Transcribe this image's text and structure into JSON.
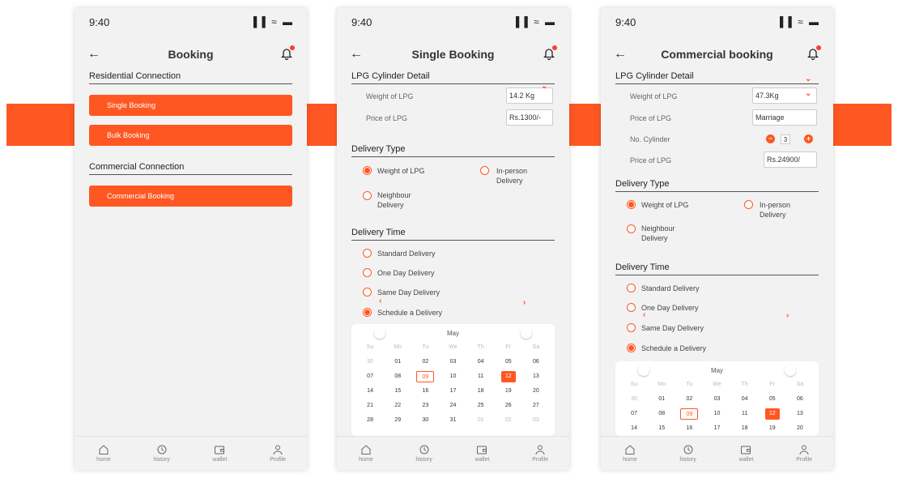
{
  "status": {
    "time": "9:40",
    "icons": "▐▐ ≈ ▬"
  },
  "screen1": {
    "title": "Booking",
    "residential_title": "Residential Connection",
    "single_booking": "Single Booking",
    "bulk_booking": "Bulk Booking",
    "commercial_title": "Commercial Connection",
    "commercial_booking": "Commercial Booking"
  },
  "screen2": {
    "title": "Single Booking",
    "cylinder_title": "LPG Cylinder Detail",
    "weight_label": "Weight of LPG",
    "weight_value": "14.2 Kg",
    "price_label": "Price of LPG",
    "price_value": "Rs.1300/-",
    "delivery_type_title": "Delivery Type",
    "dt_weight": "Weight of LPG",
    "dt_inperson_1": "In-person",
    "dt_inperson_2": "Delivery",
    "dt_neighbour_1": "Neighbour",
    "dt_neighbour_2": "Delivery",
    "delivery_time_title": "Delivery Time",
    "standard": "Standard Delivery",
    "one_day": "One Day Delivery",
    "same_day": "Same Day Delivery",
    "schedule": "Schedule a Delivery",
    "month": "May"
  },
  "screen3": {
    "title": "Commercial booking",
    "cylinder_title": "LPG Cylinder Detail",
    "weight_label": "Weight of LPG",
    "weight_value": "47.3Kg",
    "price_label_1": "Price of LPG",
    "price_value_1": "Marriage",
    "cylinders_label": "No. Cylinder",
    "cylinders_value": "3",
    "price_label_2": "Price of LPG",
    "price_value_2": "Rs.24900/",
    "delivery_type_title": "Delivery Type",
    "dt_weight": "Weight of LPG",
    "dt_inperson_1": "In-person",
    "dt_inperson_2": "Delivery",
    "dt_neighbour_1": "Neighbour",
    "dt_neighbour_2": "Delivery",
    "delivery_time_title": "Delivery Time",
    "standard": "Standard Delivery",
    "one_day": "One Day Delivery",
    "same_day": "Same Day Delivery",
    "schedule": "Schedule a Delivery",
    "month": "May"
  },
  "calendar": {
    "dow": [
      "Su",
      "Mo",
      "Tu",
      "We",
      "Th",
      "Fr",
      "Sa"
    ],
    "weeks": [
      [
        "30",
        "01",
        "02",
        "03",
        "04",
        "05",
        "06"
      ],
      [
        "07",
        "08",
        "09",
        "10",
        "11",
        "12",
        "13"
      ],
      [
        "14",
        "15",
        "16",
        "17",
        "18",
        "19",
        "20"
      ],
      [
        "21",
        "22",
        "23",
        "24",
        "25",
        "26",
        "27"
      ],
      [
        "28",
        "29",
        "30",
        "31",
        "01",
        "02",
        "03"
      ]
    ],
    "today": "09",
    "selected": "12"
  },
  "tabs": {
    "home": "home",
    "history": "history",
    "wallet": "wallet",
    "profile": "Profile"
  },
  "colors": {
    "accent": "#FF5722",
    "background": "#f2f2f2"
  },
  "icons": {
    "back": "←",
    "bell": "bell-icon"
  }
}
